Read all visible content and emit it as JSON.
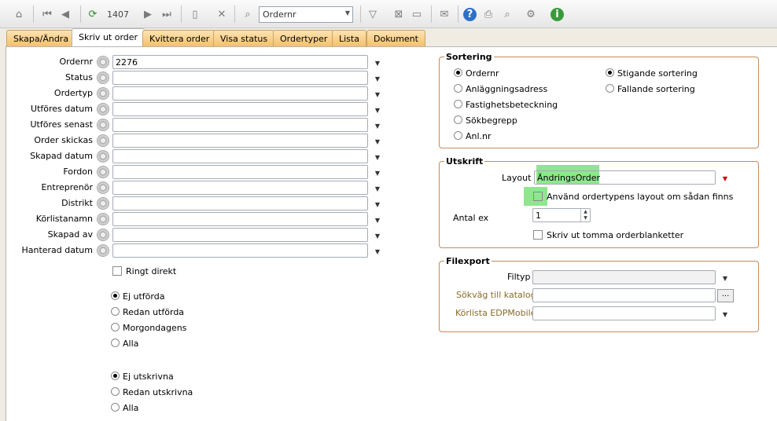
{
  "toolbar": {
    "record_number": "1407",
    "search_field": "Ordernr"
  },
  "tabs": [
    {
      "label": "Skapa/Ändra"
    },
    {
      "label": "Skriv ut order"
    },
    {
      "label": "Kvittera order"
    },
    {
      "label": "Visa status"
    },
    {
      "label": "Ordertyper"
    },
    {
      "label": "Lista"
    },
    {
      "label": "Dokument"
    }
  ],
  "filters": [
    {
      "label": "Ordernr",
      "value": "2276"
    },
    {
      "label": "Status",
      "value": ""
    },
    {
      "label": "Ordertyp",
      "value": ""
    },
    {
      "label": "Utföres datum",
      "value": ""
    },
    {
      "label": "Utföres senast",
      "value": ""
    },
    {
      "label": "Order skickas",
      "value": ""
    },
    {
      "label": "Skapad datum",
      "value": ""
    },
    {
      "label": "Fordon",
      "value": ""
    },
    {
      "label": "Entreprenör",
      "value": ""
    },
    {
      "label": "Distrikt",
      "value": ""
    },
    {
      "label": "Körlistanamn",
      "value": ""
    },
    {
      "label": "Skapad av",
      "value": ""
    },
    {
      "label": "Hanterad datum",
      "value": ""
    }
  ],
  "ringt_direkt": "Ringt direkt",
  "status_radios": [
    "Ej utförda",
    "Redan utförda",
    "Morgondagens",
    "Alla"
  ],
  "print_radios": [
    "Ej utskrivna",
    "Redan utskrivna",
    "Alla"
  ],
  "sortering": {
    "title": "Sortering",
    "fields": [
      "Ordernr",
      "Anläggningsadress",
      "Fastighetsbeteckning",
      "Sökbegrepp",
      "Anl.nr"
    ],
    "orders": [
      "Stigande sortering",
      "Fallande sortering"
    ]
  },
  "utskrift": {
    "title": "Utskrift",
    "layout_label": "Layout",
    "layout_value": "ÄndringsOrder",
    "use_type_layout": "Använd ordertypens layout om sådan finns",
    "antal_label": "Antal ex",
    "antal_value": "1",
    "empty_blanks": "Skriv ut tomma orderblanketter"
  },
  "filexport": {
    "title": "Filexport",
    "filtyp_label": "Filtyp",
    "sokvag_label": "Sökväg till katalog",
    "korlista_label": "Körlista EDPMobile",
    "browse": "..."
  }
}
